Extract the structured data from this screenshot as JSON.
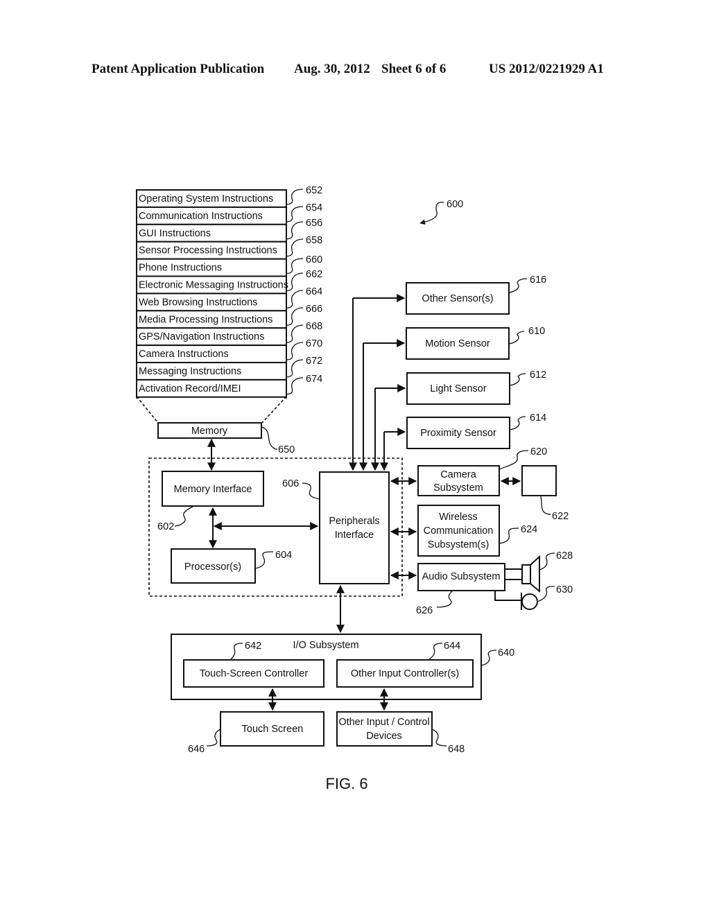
{
  "header": {
    "publication": "Patent Application Publication",
    "date": "Aug. 30, 2012",
    "sheet": "Sheet 6 of 6",
    "number": "US 2012/0221929 A1"
  },
  "figure": {
    "caption": "FIG. 6",
    "ref": "600",
    "memory_stack": [
      {
        "label": "Operating System Instructions",
        "ref": "652"
      },
      {
        "label": "Communication Instructions",
        "ref": "654"
      },
      {
        "label": "GUI Instructions",
        "ref": "656"
      },
      {
        "label": "Sensor Processing Instructions",
        "ref": "658"
      },
      {
        "label": "Phone Instructions",
        "ref": "660"
      },
      {
        "label": "Electronic Messaging Instructions",
        "ref": "662"
      },
      {
        "label": "Web Browsing Instructions",
        "ref": "664"
      },
      {
        "label": "Media Processing Instructions",
        "ref": "666"
      },
      {
        "label": "GPS/Navigation Instructions",
        "ref": "668"
      },
      {
        "label": "Camera Instructions",
        "ref": "670"
      },
      {
        "label": "Messaging Instructions",
        "ref": "672"
      },
      {
        "label": "Activation Record/IMEI",
        "ref": "674"
      }
    ],
    "memory": {
      "label": "Memory",
      "ref": "650"
    },
    "memory_interface": {
      "label": "Memory Interface",
      "ref": "602"
    },
    "processor": {
      "label": "Processor(s)",
      "ref": "604"
    },
    "peripherals": {
      "line1": "Peripherals",
      "line2": "Interface",
      "ref": "606"
    },
    "sensors": [
      {
        "label": "Other Sensor(s)",
        "ref": "616"
      },
      {
        "label": "Motion Sensor",
        "ref": "610"
      },
      {
        "label": "Light Sensor",
        "ref": "612"
      },
      {
        "label": "Proximity Sensor",
        "ref": "614"
      }
    ],
    "camera": {
      "line1": "Camera",
      "line2": "Subsystem",
      "ref": "620",
      "sensor_ref": "622"
    },
    "wireless": {
      "line1": "Wireless",
      "line2": "Communication",
      "line3": "Subsystem(s)",
      "ref": "624"
    },
    "audio": {
      "label": "Audio Subsystem",
      "ref": "626",
      "speaker_ref": "628",
      "mic_ref": "630"
    },
    "io": {
      "label": "I/O Subsystem",
      "ref": "640"
    },
    "touch_controller": {
      "label": "Touch-Screen Controller",
      "ref": "642"
    },
    "other_controller": {
      "label": "Other Input Controller(s)",
      "ref": "644"
    },
    "touch_screen": {
      "label": "Touch Screen",
      "ref": "646"
    },
    "other_devices": {
      "line1": "Other Input / Control",
      "line2": "Devices",
      "ref": "648"
    }
  }
}
